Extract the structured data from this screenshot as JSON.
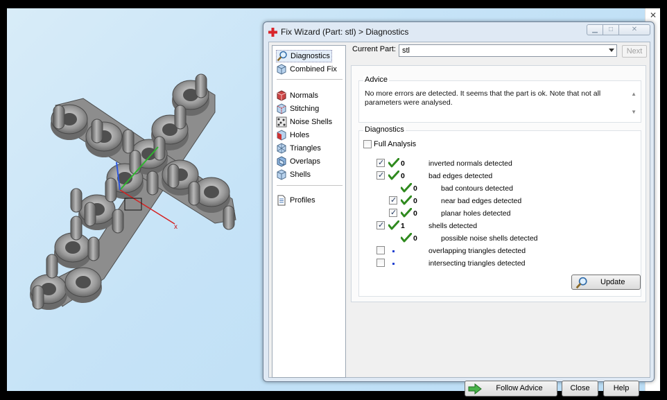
{
  "viewport": {
    "axis_x_label": "x",
    "background": "#c6e3f7",
    "part_color": "#8d8d8d"
  },
  "dialog": {
    "title": "Fix Wizard (Part: stl) > Diagnostics",
    "title_icon": "red-cross-icon",
    "current_part_label": "Current Part:",
    "current_part_value": "stl",
    "next_label": "Next",
    "nav": {
      "top_items": [
        {
          "label": "Diagnostics",
          "icon": "magnifier-icon",
          "active": true
        },
        {
          "label": "Combined Fix",
          "icon": "cube-icon"
        }
      ],
      "fix_items": [
        {
          "label": "Normals",
          "icon": "normals-cube-icon"
        },
        {
          "label": "Stitching",
          "icon": "stitching-cube-icon"
        },
        {
          "label": "Noise Shells",
          "icon": "noise-shells-icon"
        },
        {
          "label": "Holes",
          "icon": "holes-cube-icon"
        },
        {
          "label": "Triangles",
          "icon": "triangles-cube-icon"
        },
        {
          "label": "Overlaps",
          "icon": "overlaps-cube-icon"
        },
        {
          "label": "Shells",
          "icon": "shells-cube-icon"
        }
      ],
      "profiles_label": "Profiles"
    },
    "advice": {
      "title": "Advice",
      "text": "No more errors are detected. It seems that the part is ok. Note that not all parameters were analysed."
    },
    "diagnostics": {
      "title": "Diagnostics",
      "full_analysis_label": "Full Analysis",
      "rows": [
        {
          "checked": true,
          "status": "ok",
          "count": "0",
          "label": "inverted normals detected",
          "level": 0
        },
        {
          "checked": true,
          "status": "ok",
          "count": "0",
          "label": "bad edges detected",
          "level": 0
        },
        {
          "checked": null,
          "status": "ok",
          "count": "0",
          "label": "bad contours detected",
          "level": 1
        },
        {
          "checked": true,
          "status": "ok",
          "count": "0",
          "label": "near bad edges detected",
          "level": 1
        },
        {
          "checked": true,
          "status": "ok",
          "count": "0",
          "label": "planar holes detected",
          "level": 1
        },
        {
          "checked": true,
          "status": "ok",
          "count": "1",
          "label": "shells detected",
          "level": 0
        },
        {
          "checked": null,
          "status": "ok",
          "count": "0",
          "label": "possible noise shells detected",
          "level": 1
        },
        {
          "checked": false,
          "status": "unknown",
          "count": "",
          "label": "overlapping triangles detected",
          "level": 0
        },
        {
          "checked": false,
          "status": "unknown",
          "count": "",
          "label": "intersecting triangles detected",
          "level": 0
        }
      ],
      "update_label": "Update"
    },
    "buttons": {
      "follow_advice": "Follow Advice",
      "close": "Close",
      "help": "Help"
    },
    "colors": {
      "ok_tick": "#2f8a1e",
      "unknown_dot": "#1d3fd0",
      "window_frame": "#dfe9f4"
    }
  }
}
